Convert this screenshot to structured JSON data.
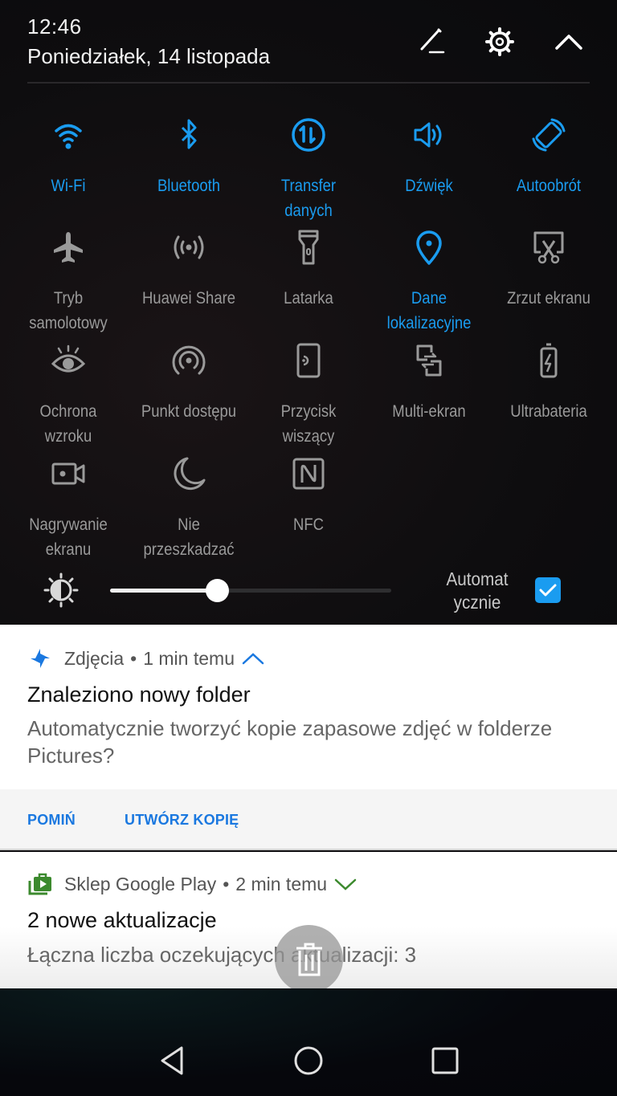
{
  "status": {
    "time": "12:46",
    "date": "Poniedziałek, 14 listopada"
  },
  "header_actions": [
    {
      "icon": "edit-icon",
      "label": "Edytuj"
    },
    {
      "icon": "gear-icon",
      "label": "Ustawienia"
    },
    {
      "icon": "chevron-up-icon",
      "label": "Zwiń"
    }
  ],
  "tiles": [
    {
      "label": "Wi-Fi",
      "icon": "wifi-icon",
      "active": true
    },
    {
      "label": "Bluetooth",
      "icon": "bluetooth-icon",
      "active": true
    },
    {
      "label": "Transfer\ndanych",
      "icon": "data-transfer-icon",
      "active": true
    },
    {
      "label": "Dźwięk",
      "icon": "sound-icon",
      "active": true
    },
    {
      "label": "Autoobrót",
      "icon": "auto-rotate-icon",
      "active": true
    },
    {
      "label": "Tryb\nsamolotowy",
      "icon": "airplane-icon",
      "active": false
    },
    {
      "label": "Huawei Share",
      "icon": "huawei-share-icon",
      "active": false
    },
    {
      "label": "Latarka",
      "icon": "flashlight-icon",
      "active": false
    },
    {
      "label": "Dane\nlokalizacyjne",
      "icon": "location-icon",
      "active": true
    },
    {
      "label": "Zrzut ekranu",
      "icon": "screenshot-icon",
      "active": false
    },
    {
      "label": "Ochrona\nwzroku",
      "icon": "eye-icon",
      "active": false
    },
    {
      "label": "Punkt dostępu",
      "icon": "hotspot-icon",
      "active": false
    },
    {
      "label": "Przycisk\nwiszący",
      "icon": "floating-button-icon",
      "active": false
    },
    {
      "label": "Multi-ekran",
      "icon": "multi-screen-icon",
      "active": false
    },
    {
      "label": "Ultrabateria",
      "icon": "battery-icon",
      "active": false
    },
    {
      "label": "Nagrywanie\nekranu",
      "icon": "screen-record-icon",
      "active": false
    },
    {
      "label": "Nie\nprzeszkadzać",
      "icon": "moon-icon",
      "active": false
    },
    {
      "label": "NFC",
      "icon": "nfc-icon",
      "active": false
    }
  ],
  "brightness": {
    "level": 0.38,
    "auto_label": "Automat\nycznie",
    "auto_checked": true
  },
  "notifications": [
    {
      "app": "Zdjęcia",
      "time": "1 min temu",
      "expanded": true,
      "title": "Znaleziono nowy folder",
      "body": "Automatycznie tworzyć kopie zapasowe zdjęć w folderze Pictures?",
      "actions": [
        "POMIŃ",
        "UTWÓRZ KOPIĘ"
      ]
    },
    {
      "app": "Sklep Google Play",
      "time": "2 min temu",
      "expanded": false,
      "title": "2 nowe aktualizacje",
      "body": "Łączna liczba oczekujących aktualizacji: 3"
    }
  ],
  "separator": "•",
  "colors": {
    "accent": "#1a9cf0",
    "inactive": "#9a9a9a",
    "action_text": "#1a78e0",
    "play_green": "#3c8a2e"
  },
  "navbar": [
    {
      "icon": "back-icon"
    },
    {
      "icon": "home-icon"
    },
    {
      "icon": "recents-icon"
    }
  ]
}
